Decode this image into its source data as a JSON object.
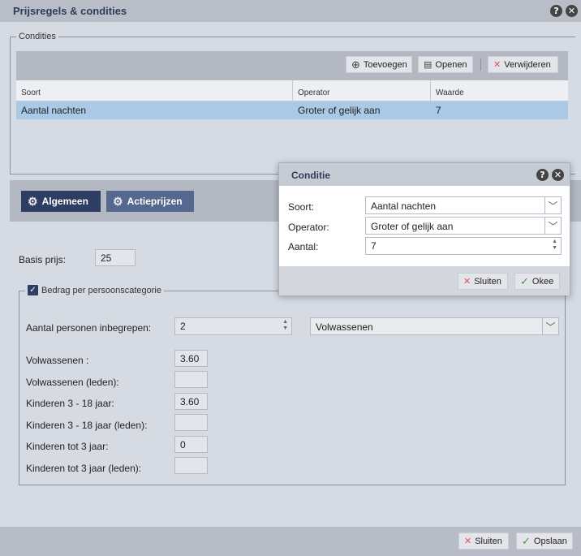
{
  "window": {
    "title": "Prijsregels & condities"
  },
  "conditions": {
    "legend": "Condities",
    "toolbar": {
      "add_label": "Toevoegen",
      "open_label": "Openen",
      "delete_label": "Verwijderen"
    },
    "columns": [
      "Soort",
      "Operator",
      "Waarde"
    ],
    "rows": [
      {
        "soort": "Aantal nachten",
        "operator": "Groter of gelijk aan",
        "waarde": "7"
      }
    ]
  },
  "tabs": {
    "general": "Algemeen",
    "action_prices": "Actieprijzen"
  },
  "general": {
    "base_price_label": "Basis prijs:",
    "base_price_value": "25",
    "person_category_legend": "Bedrag per persoonscategorie",
    "persons_included_label": "Aantal personen inbegrepen:",
    "persons_included_value": "2",
    "persons_category_select": "Volwassenen",
    "categories": [
      {
        "label": "Volwassenen :",
        "value": "3.60"
      },
      {
        "label": "Volwassenen (leden):",
        "value": ""
      },
      {
        "label": "Kinderen 3 - 18 jaar:",
        "value": "3.60"
      },
      {
        "label": "Kinderen 3 - 18 jaar (leden):",
        "value": ""
      },
      {
        "label": "Kinderen tot 3 jaar:",
        "value": "0"
      },
      {
        "label": "Kinderen tot 3 jaar (leden):",
        "value": ""
      }
    ]
  },
  "dialog": {
    "title": "Conditie",
    "soort_label": "Soort:",
    "soort_value": "Aantal nachten",
    "operator_label": "Operator:",
    "operator_value": "Groter of gelijk aan",
    "aantal_label": "Aantal:",
    "aantal_value": "7",
    "close_label": "Sluiten",
    "ok_label": "Okee"
  },
  "footer": {
    "close_label": "Sluiten",
    "save_label": "Opslaan"
  },
  "icons": {
    "help": "?",
    "close": "✕",
    "add": "⊕",
    "open": "▤",
    "delete": "✕",
    "check": "✓",
    "gear": "⚙"
  },
  "colors": {
    "accent_red": "#d9534f",
    "accent_green": "#3c9a3c",
    "tab_active": "#2e3e63",
    "tab_inactive": "#56688e",
    "row_selected": "#a9c9e6"
  }
}
